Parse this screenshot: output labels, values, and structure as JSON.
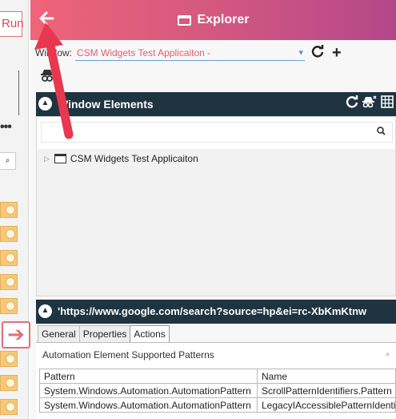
{
  "left_panel": {
    "run_label": "Run",
    "dots": "•••",
    "search_icon": "search-icon",
    "collapse_arrow_icon": "arrow-right-icon"
  },
  "explorer": {
    "title": "Explorer",
    "back_icon": "arrow-left-icon",
    "window_label": "Window:",
    "window_value": "CSM Widgets Test Applicaiton -",
    "window_chevron": "⌄",
    "refresh_icon": "refresh-icon",
    "add_icon": "plus-icon",
    "spy_icon": "spy-icon"
  },
  "window_elements": {
    "title": "Window Elements",
    "search_value": "",
    "tools": [
      "refresh-icon",
      "spy-clear-icon",
      "grid-icon"
    ],
    "tree": [
      {
        "label": "CSM Widgets Test Applicaiton",
        "expander": "▷"
      }
    ]
  },
  "details": {
    "title": "'https://www.google.com/search?source=hp&ei=rc-XbKmKtnw",
    "tabs": [
      {
        "label": "General",
        "active": false
      },
      {
        "label": "Properties",
        "active": false
      },
      {
        "label": "Actions",
        "active": true
      }
    ],
    "patterns_label": "Automation Element Supported Patterns",
    "table": {
      "columns": [
        "Pattern",
        "Name"
      ],
      "rows": [
        [
          "System.Windows.Automation.AutomationPattern",
          "ScrollPatternIdentifiers.Pattern"
        ],
        [
          "System.Windows.Automation.AutomationPattern",
          "LegacyIAccessiblePatternIdentifiers"
        ]
      ]
    }
  },
  "colors": {
    "header_gradient_start": "#ef6478",
    "header_gradient_end": "#b4478a",
    "section_header": "#1f3441",
    "accent_red": "#e8384f"
  }
}
